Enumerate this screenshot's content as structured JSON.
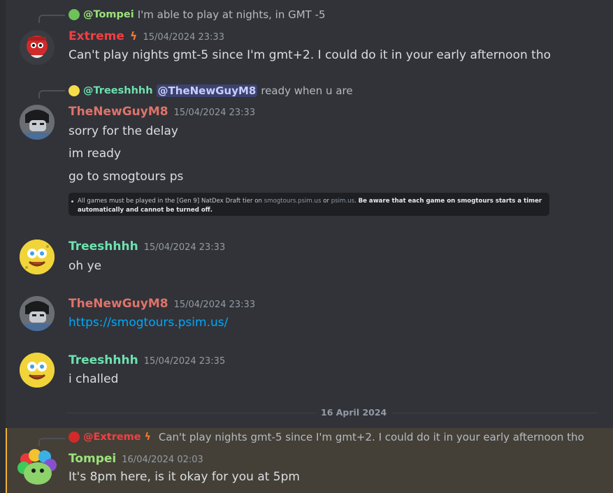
{
  "messages": [
    {
      "reply_to": {
        "name": "@Tompei",
        "text": "I'm able to play at nights, in GMT -5"
      },
      "author": "Extreme",
      "author_color": "#f23f43",
      "badge": "lightning-icon",
      "timestamp": "15/04/2024 23:33",
      "lines": [
        "Can't play nights gmt-5 since I'm gmt+2. I could do it in your early afternoon tho"
      ]
    },
    {
      "reply_to": {
        "name": "@Treeshhhh",
        "mention": "@TheNewGuyM8",
        "text": "ready when u are"
      },
      "author": "TheNewGuyM8",
      "author_color": "#e0736a",
      "timestamp": "15/04/2024 23:33",
      "lines": [
        "sorry for the delay",
        "im ready",
        "go to smogtours ps"
      ],
      "embed_rule": {
        "text_a": "All games must be played in the [Gen 9] NatDex Draft tier on",
        "link1": "smogtours.psim.us",
        "or": "or",
        "link2": "psim.us",
        "bold": "Be aware that each game on smogtours starts a timer automatically and cannot be turned off."
      }
    },
    {
      "author": "Treeshhhh",
      "author_color": "#6fe0b0",
      "timestamp": "15/04/2024 23:33",
      "lines": [
        "oh ye"
      ]
    },
    {
      "author": "TheNewGuyM8",
      "author_color": "#e0736a",
      "timestamp": "15/04/2024 23:33",
      "link": "https://smogtours.psim.us/"
    },
    {
      "author": "Treeshhhh",
      "author_color": "#6fe0b0",
      "timestamp": "15/04/2024 23:35",
      "lines": [
        "i challed"
      ]
    },
    {
      "reply_to": {
        "name": "@Extreme",
        "text": "Can't play nights gmt-5 since I'm gmt+2. I could do it in your early afternoon tho"
      },
      "author": "Tompei",
      "author_color": "#9be37a",
      "timestamp": "16/04/2024 02:03",
      "lines": [
        "It's 8pm here, is it okay for you at 5pm"
      ]
    }
  ],
  "date_divider": "16 April 2024",
  "colors": {
    "background": "#313338",
    "highlight": "#444038",
    "link": "#00a8fc",
    "mention": "#3c4270"
  }
}
